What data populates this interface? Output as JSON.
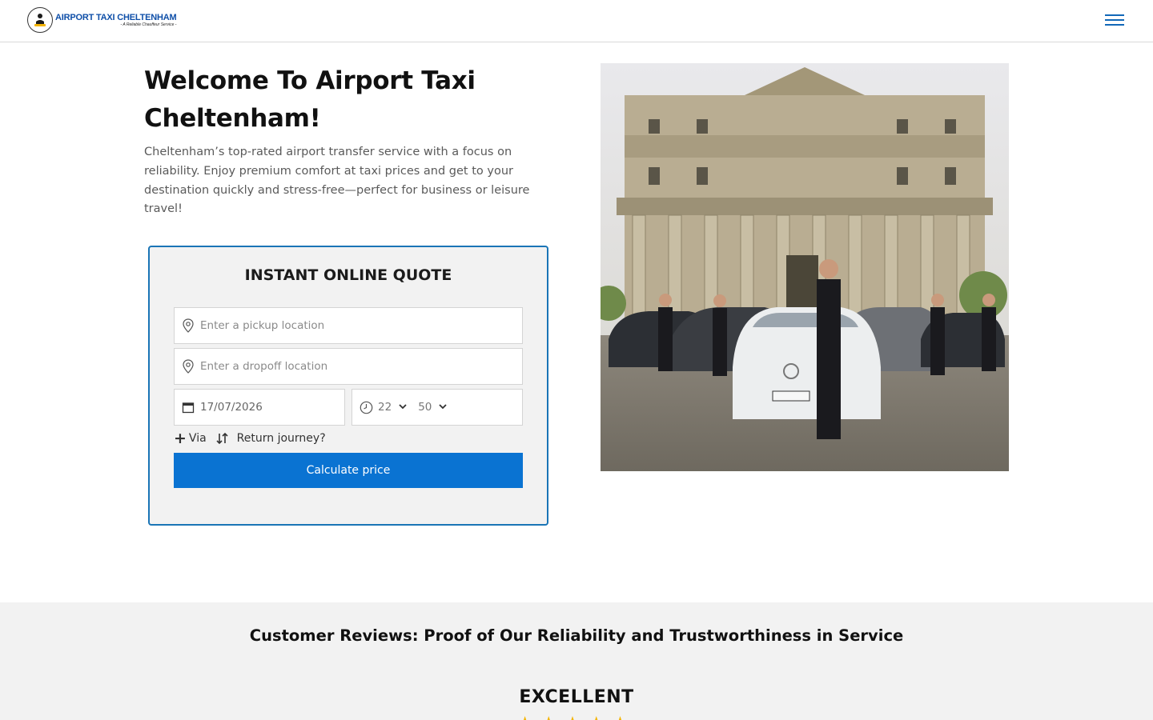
{
  "header": {
    "logo_title": "AIRPORT TAXI CHELTENHAM",
    "logo_tagline": "- A Reliable Chauffeur Service -",
    "menu_icon": "hamburger-menu-icon",
    "accent_color": "#1268b8"
  },
  "hero": {
    "title": "Welcome To Airport Taxi Cheltenham!",
    "description": "Cheltenham’s top-rated airport transfer service with a focus on reliability. Enjoy premium comfort at taxi prices and get to your destination quickly and stress-free—perfect for business or leisure travel!"
  },
  "quote_form": {
    "title": "INSTANT ONLINE QUOTE",
    "pickup_placeholder": "Enter a pickup location",
    "dropoff_placeholder": "Enter a dropoff location",
    "date_value": "17/07/2026",
    "hour_value": "22",
    "minute_value": "50",
    "via_label": "Via",
    "return_label": "Return journey?",
    "submit_label": "Calculate price",
    "border_color": "#1a75b6",
    "button_color": "#0a73d2"
  },
  "reviews": {
    "heading": "Customer Reviews: Proof of Our Reliability and Trustworthiness in Service",
    "rating_word": "EXCELLENT",
    "stars": "★★★★★",
    "star_color": "#f4b400"
  }
}
